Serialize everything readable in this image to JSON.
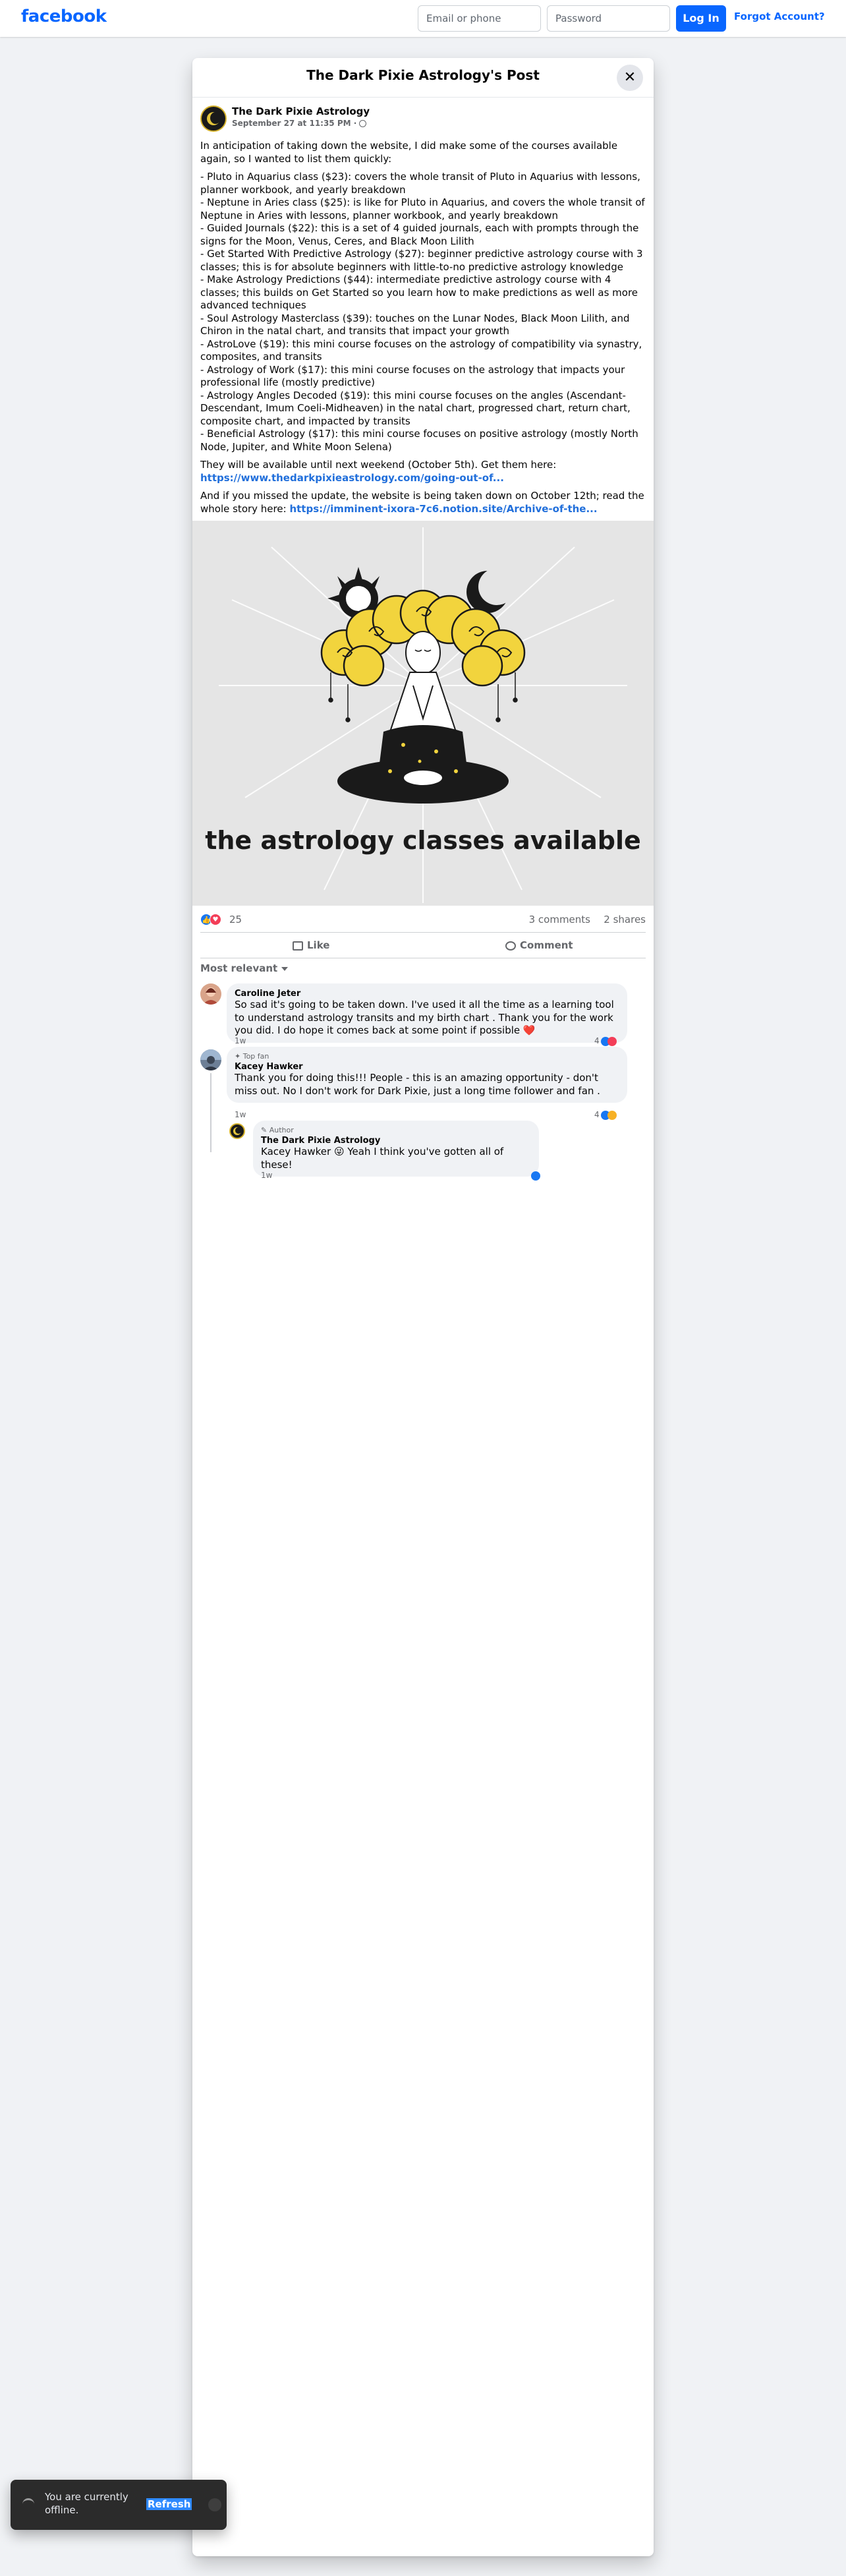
{
  "topbar": {
    "logo": "facebook",
    "email_placeholder": "Email or phone",
    "password_placeholder": "Password",
    "login_label": "Log In",
    "forgot_label": "Forgot Account?"
  },
  "dialog": {
    "title": "The Dark Pixie Astrology's Post",
    "close_icon": "close-icon"
  },
  "post": {
    "author": "The Dark Pixie Astrology",
    "time": "September 27 at 11:35 PM ·",
    "intro": "In anticipation of taking down the website, I did make some of the courses available again, so I wanted to list them quickly:",
    "courses": [
      "- Pluto in Aquarius class ($23): covers the whole transit of Pluto in Aquarius with lessons, planner workbook, and yearly breakdown",
      "- Neptune in Aries class ($25): is like for Pluto in Aquarius, and covers the whole transit of Neptune in Aries with lessons, planner workbook, and yearly breakdown",
      "- Guided Journals ($22): this is a set of 4 guided journals, each with prompts through the signs for the Moon, Venus, Ceres, and Black Moon Lilith",
      "- Get Started With Predictive Astrology ($27): beginner predictive astrology course with 3 classes; this is for absolute beginners with little-to-no predictive astrology knowledge",
      "- Make Astrology Predictions ($44): intermediate predictive astrology course with 4 classes; this builds on Get Started so you learn how to make predictions as well as more advanced techniques",
      "- Soul Astrology Masterclass ($39): touches on the Lunar Nodes, Black Moon Lilith, and Chiron in the natal chart, and transits that impact your growth",
      "- AstroLove ($19): this mini course focuses on the astrology of compatibility via synastry, composites, and transits",
      "- Astrology of Work ($17): this mini course focuses on the astrology that impacts your professional life (mostly predictive)",
      "- Astrology Angles Decoded ($19): this mini course focuses on the angles (Ascendant-Descendant, Imum Coeli-Midheaven) in the natal chart, progressed chart, return chart, composite chart, and impacted by transits",
      "- Beneficial Astrology ($17): this mini course focuses on positive astrology (mostly North Node, Jupiter, and White Moon Selena)"
    ],
    "available_text": "They will be available until next weekend (October 5th). Get them here:",
    "available_link": "https://www.thedarkpixieastrology.com/going-out-of...",
    "update_text": "And if you missed the update, the website is being taken down on October 12th; read the whole story here:",
    "update_link": "https://imminent-ixora-7c6.notion.site/Archive-of-the...",
    "image_caption": "the astrology classes available",
    "reaction_count": "25",
    "comments_count": "3 comments",
    "shares_count": "2 shares",
    "like_label": "Like",
    "comment_label": "Comment",
    "sort_label": "Most relevant"
  },
  "comments": [
    {
      "name": "Caroline Jeter",
      "text": "So sad it's going to be taken down. I've used it all the time as a learning tool to understand astrology transits and my birth chart . Thank you for the work you did. I do hope it comes back at some point if possible ❤️",
      "time": "1w",
      "reacts": "4"
    },
    {
      "badge": "Top fan",
      "name": "Kacey Hawker",
      "text": "Thank you for doing this!!! People - this is an amazing opportunity - don't miss out. No I don't work for Dark Pixie, just a long time follower and fan .",
      "time": "1w",
      "reacts": "4"
    },
    {
      "badge": "Author",
      "name": "The Dark Pixie Astrology",
      "mention": "Kacey Hawker",
      "text": "😜 Yeah I think you've gotten all of these!",
      "time": "1w"
    }
  ],
  "toast": {
    "text": "You are currently offline.",
    "refresh_label": "Refresh"
  },
  "colors": {
    "brand": "#0866ff",
    "link": "#216fdb",
    "background": "#f0f2f5",
    "text_secondary": "#65676b"
  }
}
